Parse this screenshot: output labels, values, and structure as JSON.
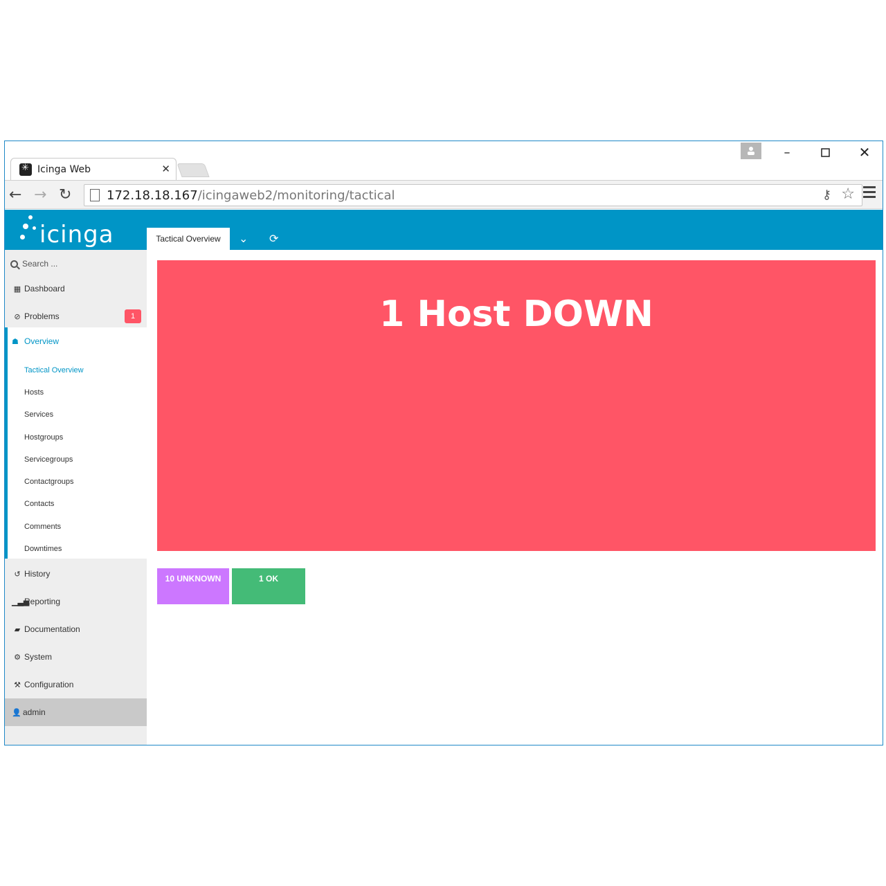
{
  "browser": {
    "tab_title": "Icinga Web",
    "url_host": "172.18.18.167",
    "url_path": "/icingaweb2/monitoring/tactical"
  },
  "app": {
    "logo_text": "icinga",
    "header_tab": "Tactical Overview",
    "search_placeholder": "Search ...",
    "nav": {
      "dashboard": "Dashboard",
      "problems": "Problems",
      "problems_badge": "1",
      "overview": "Overview",
      "overview_items": [
        "Tactical Overview",
        "Hosts",
        "Services",
        "Hostgroups",
        "Servicegroups",
        "Contactgroups",
        "Contacts",
        "Comments",
        "Downtimes"
      ],
      "history": "History",
      "reporting": "Reporting",
      "documentation": "Documentation",
      "system": "System",
      "configuration": "Configuration",
      "user": "admin"
    }
  },
  "tactical": {
    "host_down_label": "1 Host DOWN",
    "service_unknown_label": "10 UNKNOWN",
    "service_ok_label": "1 OK"
  },
  "colors": {
    "header": "#0095c6",
    "down": "#ff5566",
    "unknown": "#cc77ff",
    "ok": "#44bb77",
    "badge": "#ff5566"
  }
}
